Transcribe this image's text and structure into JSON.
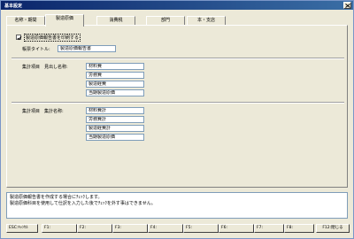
{
  "window": {
    "title": "基本設定"
  },
  "tabs": [
    {
      "label": "名称・期間"
    },
    {
      "label": "製造原価"
    },
    {
      "label": "消費税"
    },
    {
      "label": "部門"
    },
    {
      "label": "本・支店"
    }
  ],
  "form": {
    "checkbox_label": "製造原価報告書を印刷する",
    "checkbox_checked": true,
    "title_label": "帳票タイトル:",
    "title_value": "製造原価報告書",
    "heading_label": "集計項目　見出し名称:",
    "heading_values": [
      "材料費",
      "労務費",
      "製造経費",
      "当期製造原価"
    ],
    "total_label": "集計項目　集計名称:",
    "total_values": [
      "材料費計",
      "労務費計",
      "製造経費計",
      "当期製造原価"
    ]
  },
  "help": {
    "line1": "製造原価報告書を作成する場合にﾁｪｯｸします。",
    "line2": "製造原価科目を使用して仕訳を入力した後でﾁｪｯｸを外す事はできません。"
  },
  "fkeys": [
    {
      "label": "ESC:ｷｬﾝｾﾙ"
    },
    {
      "label": "F1:"
    },
    {
      "label": "F2:"
    },
    {
      "label": "F3:"
    },
    {
      "label": "F4:"
    },
    {
      "label": "F5:"
    },
    {
      "label": "F6:"
    },
    {
      "label": "F7:"
    },
    {
      "label": "F8:"
    },
    {
      "label": "F12:閉じる"
    }
  ]
}
